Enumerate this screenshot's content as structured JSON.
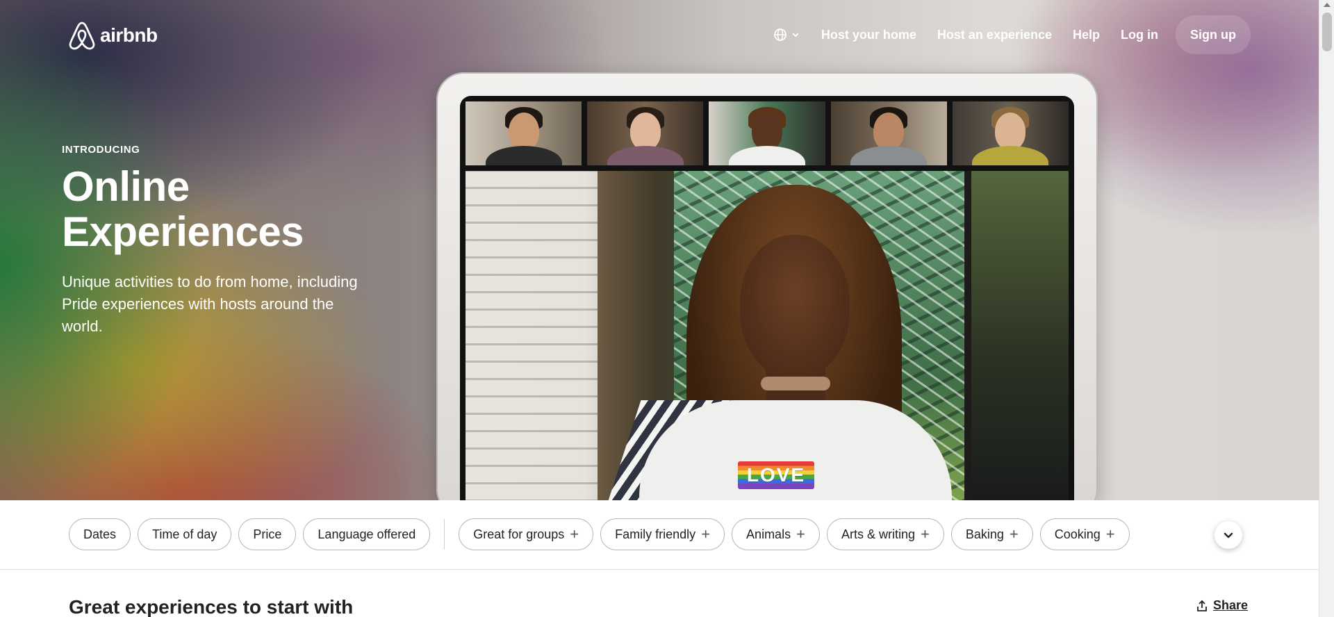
{
  "brand": {
    "name": "airbnb",
    "logo_icon": "airbnb-belo-icon"
  },
  "nav": {
    "globe_icon": "globe-icon",
    "chevron_icon": "chevron-down-icon",
    "links": [
      "Host your home",
      "Host an experience",
      "Help",
      "Log in"
    ],
    "signup_label": "Sign up"
  },
  "hero": {
    "eyebrow": "INTRODUCING",
    "title_line1": "Online",
    "title_line2": "Experiences",
    "subtitle": "Unique activities to do from home, including Pride experiences with hosts around the world.",
    "badge_text": "LOVE"
  },
  "filters": {
    "primary": [
      "Dates",
      "Time of day",
      "Price",
      "Language offered"
    ],
    "categories": [
      "Great for groups",
      "Family friendly",
      "Animals",
      "Arts & writing",
      "Baking",
      "Cooking"
    ],
    "expand_icon": "chevron-down-icon"
  },
  "section": {
    "title": "Great experiences to start with",
    "share_label": "Share",
    "share_icon": "share-icon"
  },
  "colors": {
    "text": "#222222",
    "chip_border": "#b9b9b9",
    "white": "#ffffff"
  }
}
